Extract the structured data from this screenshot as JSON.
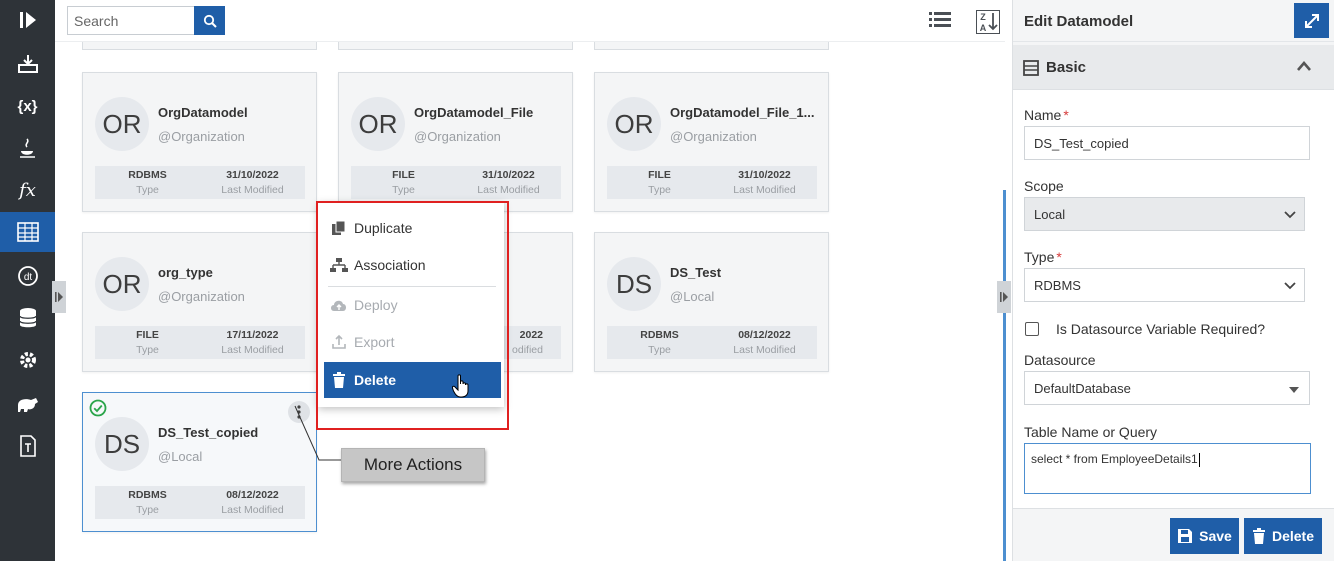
{
  "search": {
    "placeholder": "Search"
  },
  "cards": [
    {
      "initials": "OR",
      "name": "OrgDatamodel",
      "scope": "@Organization",
      "type": "RDBMS",
      "type_label": "Type",
      "modified": "31/10/2022",
      "modified_label": "Last Modified"
    },
    {
      "initials": "OR",
      "name": "OrgDatamodel_File",
      "scope": "@Organization",
      "type": "FILE",
      "type_label": "Type",
      "modified": "31/10/2022",
      "modified_label": "Last Modified"
    },
    {
      "initials": "OR",
      "name": "OrgDatamodel_File_1...",
      "scope": "@Organization",
      "type": "FILE",
      "type_label": "Type",
      "modified": "31/10/2022",
      "modified_label": "Last Modified"
    },
    {
      "initials": "OR",
      "name": "org_type",
      "scope": "@Organization",
      "type": "FILE",
      "type_label": "Type",
      "modified": "17/11/2022",
      "modified_label": "Last Modified"
    },
    {
      "initials": "",
      "name": "",
      "scope": "",
      "type": "",
      "type_label": "",
      "modified": "2022",
      "modified_label": "odified"
    },
    {
      "initials": "DS",
      "name": "DS_Test",
      "scope": "@Local",
      "type": "RDBMS",
      "type_label": "Type",
      "modified": "08/12/2022",
      "modified_label": "Last Modified"
    },
    {
      "initials": "DS",
      "name": "DS_Test_copied",
      "scope": "@Local",
      "type": "RDBMS",
      "type_label": "Type",
      "modified": "08/12/2022",
      "modified_label": "Last Modified"
    }
  ],
  "context_menu": {
    "duplicate": "Duplicate",
    "association": "Association",
    "deploy": "Deploy",
    "export": "Export",
    "delete": "Delete"
  },
  "callout": {
    "label": "More Actions"
  },
  "panel": {
    "title": "Edit Datamodel",
    "section": "Basic",
    "name_label": "Name",
    "name_value": "DS_Test_copied",
    "scope_label": "Scope",
    "scope_value": "Local",
    "type_label": "Type",
    "type_value": "RDBMS",
    "checkbox_label": "Is Datasource Variable Required?",
    "datasource_label": "Datasource",
    "datasource_value": "DefaultDatabase",
    "query_label": "Table Name or Query",
    "query_value": "select * from EmployeeDetails1",
    "required_mark": "*",
    "save": "Save",
    "delete": "Delete"
  },
  "icons": {
    "rail": [
      "logo-icon",
      "download-tray-icon",
      "variable-icon",
      "java-icon",
      "function-icon",
      "table-icon",
      "datetime-icon",
      "database-icon",
      "settings-gear-icon",
      "hippo-icon",
      "text-template-icon"
    ],
    "toolbar": [
      "list-view-icon",
      "sort-az-icon"
    ]
  },
  "colors": {
    "accent": "#1f5ea8",
    "rail": "#2e3338",
    "highlight": "#e02020",
    "check": "#2aa54a"
  }
}
